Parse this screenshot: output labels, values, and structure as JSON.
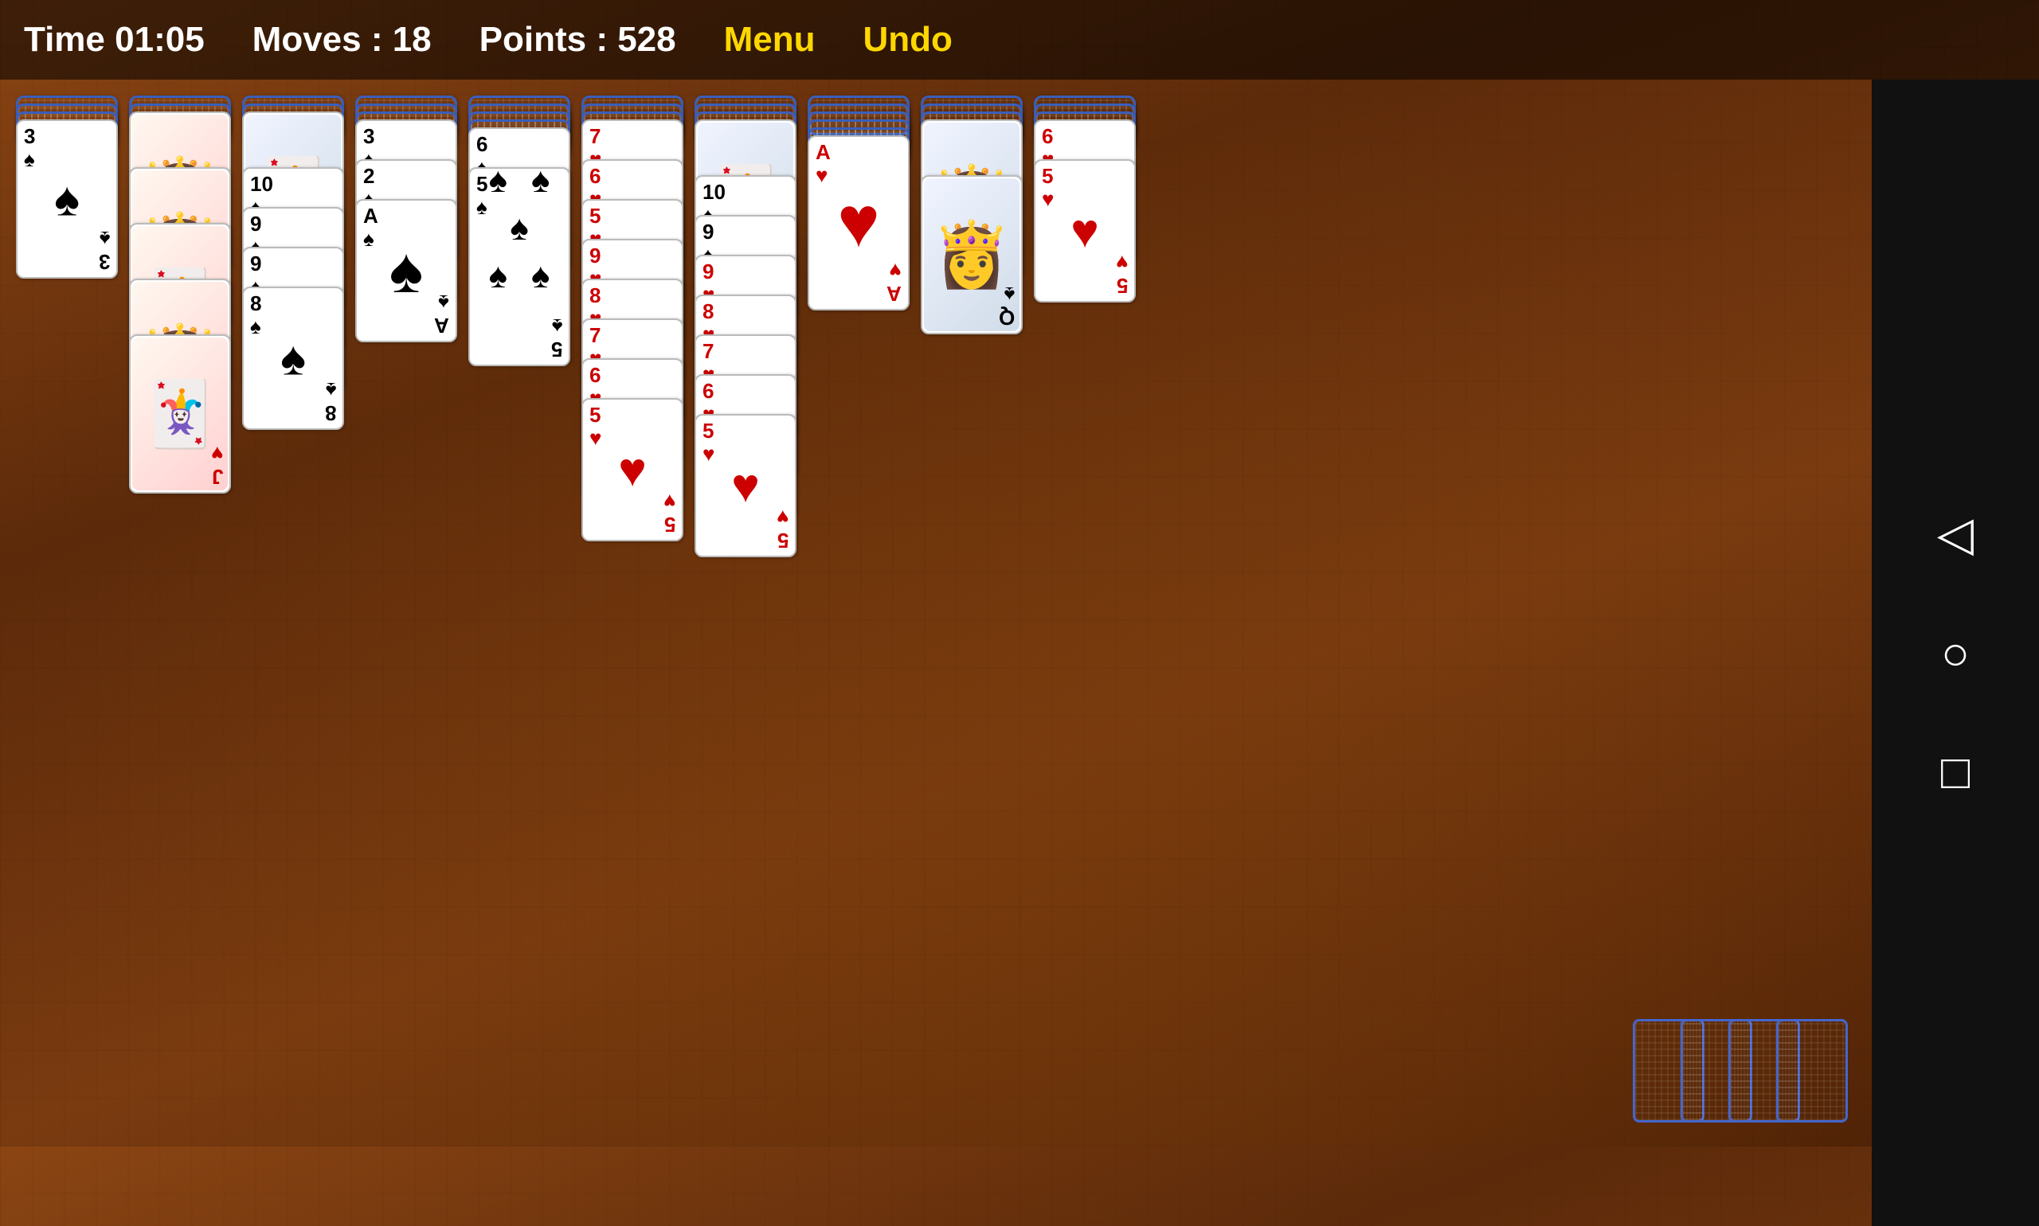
{
  "header": {
    "time_label": "Time 01:05",
    "moves_label": "Moves : 18",
    "points_label": "Points : 528",
    "menu_label": "Menu",
    "undo_label": "Undo"
  },
  "nav": {
    "back_icon": "◁",
    "circle_icon": "○",
    "square_icon": "□"
  },
  "columns": [
    {
      "id": "col1",
      "cards": [
        {
          "rank": "3",
          "suit": "♠",
          "color": "black",
          "face_down": false,
          "is_face_card": false
        }
      ]
    }
  ]
}
